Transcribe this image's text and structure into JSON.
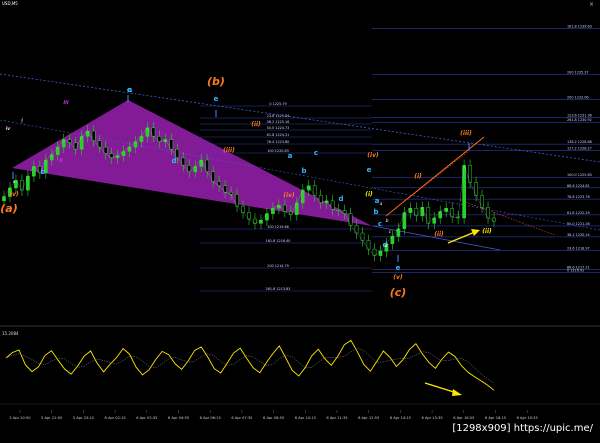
{
  "window": {
    "symbol": "USD,M5",
    "indicator_label": "15.2084"
  },
  "watermark": "[1298x909] https://upic.me/",
  "colors": {
    "background": "#000000",
    "candle": "#2bd02b",
    "purple_fill": "#9a1fb0",
    "fib_line": "#3a4bd0",
    "trend_line": "#4a5bd8",
    "orange_wave": "#ff7a1c",
    "blue_wave": "#37b6ff",
    "yellow": "#ffe800",
    "violet_wave": "#c13bd6",
    "red_dash": "#ff3b3b",
    "arrow_blue": "#4a8cff"
  },
  "chart_data": [
    {
      "type": "line",
      "title": "",
      "description_series": "price",
      "x_ticks": [
        "5 Apr 20:50",
        "5 Apr 21:50",
        "5 Apr 23:10",
        "6 Apr 02:15",
        "6 Apr 03:35",
        "6 Apr 04:55",
        "6 Apr 06:15",
        "6 Apr 07:35",
        "6 Apr 08:55",
        "6 Apr 10:15",
        "6 Apr 11:35",
        "6 Apr 12:55",
        "6 Apr 14:15",
        "6 Apr 15:35",
        "6 Apr 16:55",
        "6 Apr 18:15",
        "6 Apr 19:35"
      ],
      "price_close": [
        1224.0,
        1224.8,
        1225.5,
        1224.6,
        1225.9,
        1226.8,
        1226.2,
        1227.4,
        1227.9,
        1228.6,
        1229.3,
        1229.0,
        1228.4,
        1229.6,
        1230.1,
        1229.2,
        1228.6,
        1228.0,
        1227.6,
        1227.8,
        1228.2,
        1228.6,
        1229.1,
        1229.6,
        1230.4,
        1229.6,
        1229.1,
        1229.3,
        1228.4,
        1227.6,
        1226.9,
        1226.3,
        1226.8,
        1227.4,
        1226.3,
        1225.4,
        1225.0,
        1224.4,
        1224.2,
        1223.1,
        1222.5,
        1221.9,
        1221.5,
        1221.8,
        1222.4,
        1222.9,
        1223.2,
        1222.6,
        1222.3,
        1223.4,
        1224.6,
        1225.0,
        1224.1,
        1223.4,
        1223.6,
        1222.8,
        1222.7,
        1222.4,
        1221.3,
        1220.6,
        1219.9,
        1219.1,
        1218.5,
        1218.9,
        1219.6,
        1220.3,
        1221.0,
        1222.5,
        1222.9,
        1222.2,
        1223.0,
        1221.5,
        1222.0,
        1222.6,
        1222.9,
        1222.1,
        1222.0,
        1226.9,
        1225.3,
        1224.1,
        1223.0,
        1222.0,
        1221.7
      ],
      "fib_levels_upper": [
        {
          "label": "161.8 1239.63",
          "value": 1239.63
        },
        {
          "label": "200 1235.37",
          "value": 1235.37
        },
        {
          "label": "200 1233.06",
          "value": 1233.06
        },
        {
          "label": "261.8 1230.92",
          "value": 1230.92
        },
        {
          "label": "123.6 1231.36",
          "value": 1231.36
        },
        {
          "label": "138.2 1228.88",
          "value": 1228.88
        },
        {
          "label": "127.2 1228.27",
          "value": 1228.27
        },
        {
          "label": "100.0 1225.80",
          "value": 1225.8
        },
        {
          "label": "88.6 1224.81",
          "value": 1224.81
        },
        {
          "label": "78.6 1223.76",
          "value": 1223.76
        },
        {
          "label": "61.8 1222.29",
          "value": 1222.29
        },
        {
          "label": "50.0 1221.26",
          "value": 1221.26
        },
        {
          "label": "38.2 1220.24",
          "value": 1220.24
        },
        {
          "label": "23.6 1218.97",
          "value": 1218.97
        },
        {
          "label": "88.6 1217.21",
          "value": 1217.21
        },
        {
          "label": "0 1216.92",
          "value": 1216.92
        }
      ],
      "fib_levels_left": [
        {
          "label": "0 1225.79"
        },
        {
          "label": "23.6 1225.84"
        },
        {
          "label": "38.2 1225.16"
        },
        {
          "label": "50.0 1224.73"
        },
        {
          "label": "61.8 1224.31"
        },
        {
          "label": "76.4 1223.80"
        },
        {
          "label": "100 1220.83"
        },
        {
          "label": "100 1219.66"
        },
        {
          "label": "161.8 1216.40"
        },
        {
          "label": "200 1214.79"
        },
        {
          "label": "261.8 1213.83"
        }
      ],
      "wave_labels": {
        "orange_big": [
          "(a)",
          "(b)",
          "(c)"
        ],
        "orange_small": [
          "(v)",
          "(iv)",
          "(ii)",
          "(iv)",
          "(iii)",
          "(i)",
          "(v)",
          "(ii)",
          "(iii)",
          "(i)",
          "(ii)"
        ],
        "blue": [
          "a",
          "b",
          "c",
          "d",
          "e",
          "a",
          "b",
          "c",
          "d",
          "e",
          "a",
          "b",
          "c",
          "d",
          "e"
        ],
        "violet": [
          "iii",
          "i",
          "ii",
          "iv"
        ],
        "small": [
          "iv",
          "i",
          "v",
          "a",
          "b",
          "c",
          "d"
        ]
      },
      "annotation_arrow": "up-right toward (iv)"
    },
    {
      "type": "line",
      "title": "",
      "label": "15.2084",
      "series_main": [
        12.0,
        13.5,
        14.2,
        10.1,
        8.3,
        9.6,
        12.7,
        14.0,
        11.4,
        9.0,
        7.6,
        9.8,
        12.5,
        13.9,
        10.6,
        8.2,
        10.3,
        12.1,
        14.6,
        13.0,
        9.5,
        7.4,
        8.8,
        11.6,
        13.8,
        12.9,
        10.4,
        8.9,
        11.2,
        14.1,
        15.0,
        12.3,
        9.1,
        7.9,
        10.6,
        13.4,
        14.7,
        11.9,
        9.3,
        8.0,
        10.7,
        13.2,
        15.3,
        12.0,
        8.6,
        7.1,
        9.4,
        12.6,
        14.4,
        11.8,
        10.0,
        12.5,
        15.6,
        16.8,
        13.7,
        10.2,
        8.4,
        11.1,
        13.9,
        12.2,
        9.7,
        11.5,
        14.3,
        15.9,
        13.1,
        10.8,
        9.2,
        11.7,
        13.6,
        12.4,
        9.9,
        8.1,
        6.9,
        5.8,
        4.6,
        3.2
      ]
    }
  ]
}
